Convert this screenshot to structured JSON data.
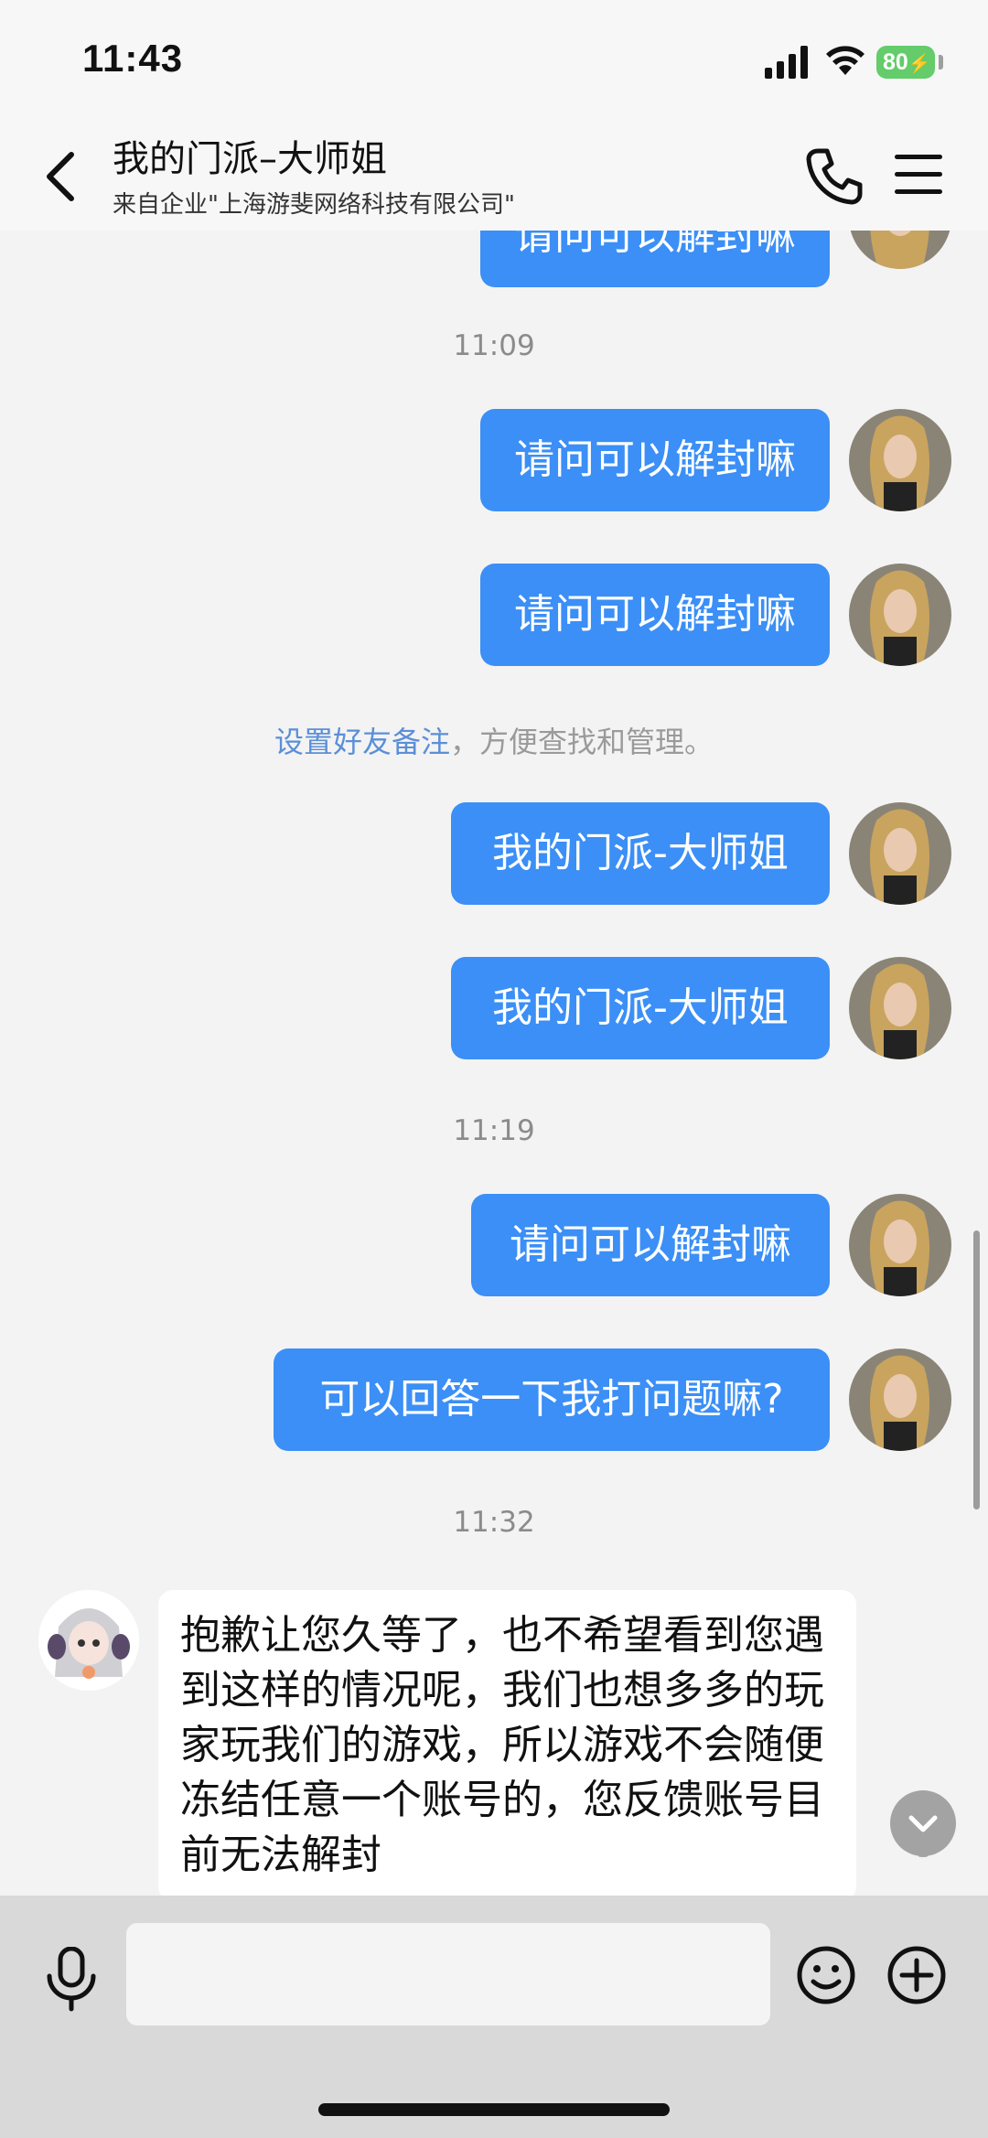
{
  "status": {
    "time": "11:43",
    "battery": "80"
  },
  "header": {
    "title": "我的门派–大师姐",
    "subtitle": "来自企业\"上海游斐网络科技有限公司\""
  },
  "messages": {
    "partial_top": "请问可以解封嘛",
    "time_1": "11:09",
    "msg_1": "请问可以解封嘛",
    "msg_2": "请问可以解封嘛",
    "sys_link": "设置好友备注",
    "sys_rest": "，方便查找和管理。",
    "msg_3": "我的门派-大师姐",
    "msg_4": "我的门派-大师姐",
    "time_2": "11:19",
    "msg_5": "请问可以解封嘛",
    "msg_6": "可以回答一下我打问题嘛?",
    "time_3": "11:32",
    "reply": "抱歉让您久等了，也不希望看到您遇到这样的情况呢，我们也想多多的玩家玩我们的游戏，所以游戏不会随便冻结任意一个账号的，您反馈账号目前无法解封"
  },
  "input": {
    "placeholder": ""
  },
  "colors": {
    "bubble_out": "#3b8ff6",
    "link": "#5b8fd8",
    "battery": "#64cc6a"
  }
}
